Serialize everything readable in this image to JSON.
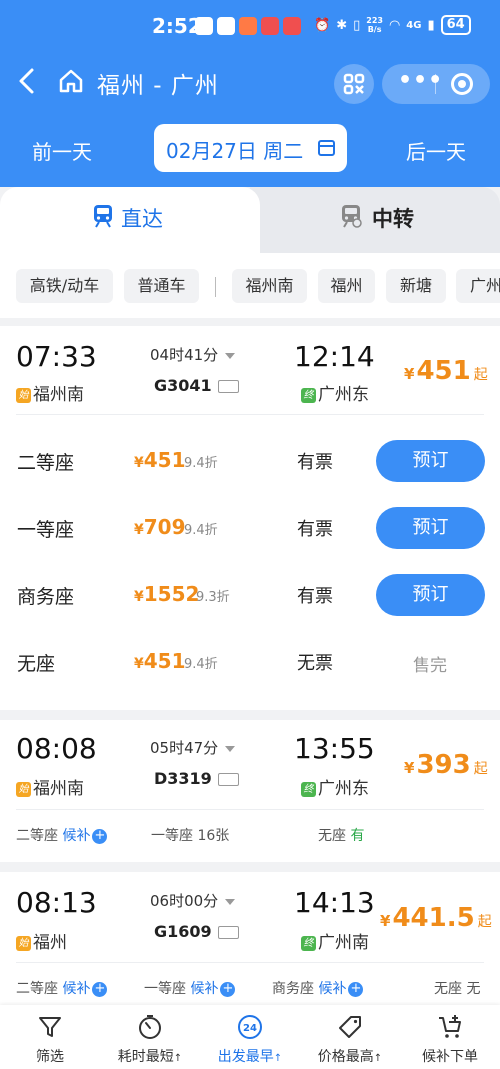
{
  "status_bar": {
    "time": "2:52",
    "speed_top": "223",
    "speed_unit": "B/s",
    "network": "4G",
    "battery": "64"
  },
  "header": {
    "title": "福州 - 广州",
    "prev_day": "前一天",
    "next_day": "后一天",
    "date": "02月27日 周二",
    "accent_color": "#3a8ef6"
  },
  "tabs": [
    {
      "label": "直达",
      "active": true
    },
    {
      "label": "中转",
      "active": false
    }
  ],
  "filters": [
    "高铁/动车",
    "普通车",
    "福州南",
    "福州",
    "新塘",
    "广州"
  ],
  "trains": [
    {
      "dep_time": "07:33",
      "arr_time": "12:14",
      "duration": "04时41分",
      "train_no": "G3041",
      "from_badge": "始",
      "from": "福州南",
      "to_badge": "终",
      "to": "广州东",
      "price_yen": "¥",
      "price": "451",
      "price_suffix": "起",
      "seats": [
        {
          "name": "二等座",
          "yen": "¥",
          "price": "451",
          "discount": "9.4折",
          "avail": "有票",
          "action": "预订"
        },
        {
          "name": "一等座",
          "yen": "¥",
          "price": "709",
          "discount": "9.4折",
          "avail": "有票",
          "action": "预订"
        },
        {
          "name": "商务座",
          "yen": "¥",
          "price": "1552",
          "discount": "9.3折",
          "avail": "有票",
          "action": "预订"
        },
        {
          "name": "无座",
          "yen": "¥",
          "price": "451",
          "discount": "9.4折",
          "avail": "无票",
          "action": "售完"
        }
      ]
    },
    {
      "dep_time": "08:08",
      "arr_time": "13:55",
      "duration": "05时47分",
      "train_no": "D3319",
      "from_badge": "始",
      "from": "福州南",
      "to_badge": "终",
      "to": "广州东",
      "price_yen": "¥",
      "price": "393",
      "price_suffix": "起",
      "mini": [
        {
          "name": "二等座",
          "status": "候补"
        },
        {
          "name": "一等座",
          "status": "16张"
        },
        {
          "name": "无座",
          "status": "有"
        }
      ]
    },
    {
      "dep_time": "08:13",
      "arr_time": "14:13",
      "duration": "06时00分",
      "train_no": "G1609",
      "from_badge": "始",
      "from": "福州",
      "to_badge": "终",
      "to": "广州南",
      "price_yen": "¥",
      "price": "441.5",
      "price_suffix": "起",
      "mini": [
        {
          "name": "二等座",
          "status": "候补"
        },
        {
          "name": "一等座",
          "status": "候补"
        },
        {
          "name": "商务座",
          "status": "候补"
        },
        {
          "name": "无座",
          "status": "无"
        }
      ]
    }
  ],
  "bottom_nav": [
    {
      "label": "筛选",
      "icon": "filter-icon"
    },
    {
      "label": "耗时最短",
      "icon": "timer-icon",
      "sort_mark": "↑"
    },
    {
      "label": "出发最早",
      "icon": "clock-24-icon",
      "sort_mark": "↑",
      "active": true,
      "calendar_number": "24"
    },
    {
      "label": "价格最高",
      "icon": "price-tag-icon",
      "sort_mark": "↑"
    },
    {
      "label": "候补下单",
      "icon": "cart-add-icon"
    }
  ]
}
